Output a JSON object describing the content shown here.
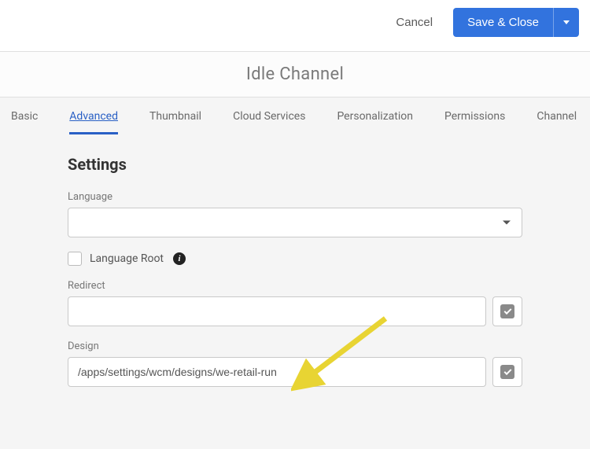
{
  "actions": {
    "cancel": "Cancel",
    "save": "Save & Close"
  },
  "title": "Idle Channel",
  "tabs": [
    {
      "label": "Basic",
      "active": false
    },
    {
      "label": "Advanced",
      "active": true
    },
    {
      "label": "Thumbnail",
      "active": false
    },
    {
      "label": "Cloud Services",
      "active": false
    },
    {
      "label": "Personalization",
      "active": false
    },
    {
      "label": "Permissions",
      "active": false
    },
    {
      "label": "Channel",
      "active": false
    }
  ],
  "settings": {
    "heading": "Settings",
    "language_label": "Language",
    "language_value": "",
    "language_root_label": "Language Root",
    "language_root_checked": false,
    "redirect_label": "Redirect",
    "redirect_value": "",
    "design_label": "Design",
    "design_value": "/apps/settings/wcm/designs/we-retail-run"
  }
}
